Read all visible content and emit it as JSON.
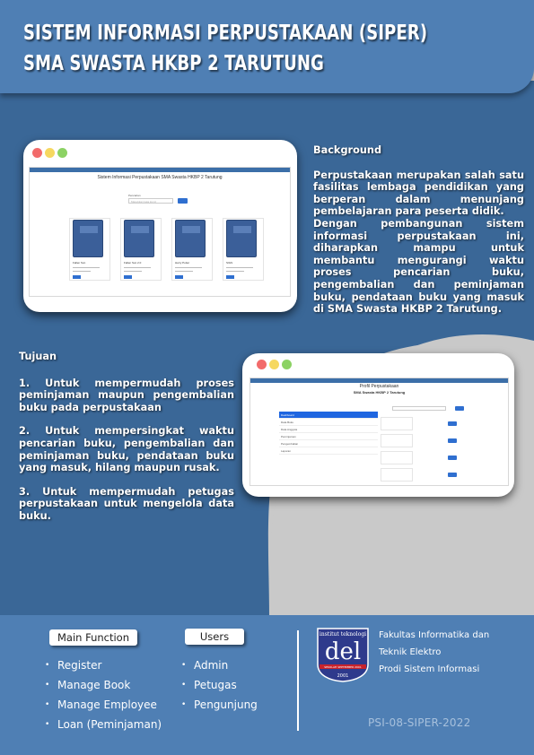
{
  "header": {
    "title_line1": "SISTEM INFORMASI PERPUSTAKAAN (SIPER)",
    "title_line2": "SMA SWASTA HKBP 2 TARUTUNG"
  },
  "colors": {
    "primary_blue": "#4f7fb4",
    "dark_blue": "#3a6797",
    "background_gray": "#c9c9c9",
    "button_blue": "#2f6fd0"
  },
  "mockup1": {
    "screen_title": "Sistem Informasi Perpustakaan SMA Swasta HKBP 2 Tarutung",
    "search_label": "Pencarian",
    "search_placeholder": "Masukkan kata kunci",
    "search_button": "Search",
    "books": [
      {
        "title": "Fallen Sun",
        "meta": "Penulis/Pengarang : Penerbit"
      },
      {
        "title": "Fallen Sun 2.0",
        "meta": "Penulis/Pengarang : Penerbit"
      },
      {
        "title": "Harry Potter",
        "meta": "Penulis/Pengarang : Penerbit"
      },
      {
        "title": "SIGS",
        "meta": "Penulis/Pengarang : Penerbit"
      }
    ],
    "book_button": "Detail"
  },
  "mockup2": {
    "screen_title": "Profil Perpustakaan",
    "screen_subtitle": "SMA Swasta HKBP 2 Tarutung",
    "menu": [
      "Dashboard",
      "Data Buku",
      "Data Anggota",
      "Peminjaman",
      "Pengembalian",
      "Laporan"
    ]
  },
  "background": {
    "heading": "Background",
    "paragraph1": "Perpustakaan merupakan salah satu fasilitas lembaga pendidikan yang berperan dalam menunjang pembelajaran para peserta didik.",
    "paragraph2": "Dengan pembangunan sistem informasi perpustakaan ini, diharapkan mampu untuk membantu mengurangi waktu proses pencarian buku, pengembalian dan peminjaman buku, pendataan buku yang masuk di SMA Swasta HKBP 2 Tarutung."
  },
  "tujuan": {
    "heading": "Tujuan",
    "items": [
      "1. Untuk mempermudah proses peminjaman maupun pengembalian buku pada perpustakaan",
      "2. Untuk mempersingkat waktu pencarian buku, pengembalian dan peminjaman buku, pendataan buku yang masuk, hilang maupun rusak.",
      "3. Untuk mempermudah petugas perpustakaan untuk mengelola data buku."
    ]
  },
  "footer": {
    "main_function_label": "Main Function",
    "main_functions": [
      "Register",
      "Manage Book",
      "Manage Employee",
      "Loan (Peminjaman)"
    ],
    "users_label": "Users",
    "users": [
      "Admin",
      "Petugas",
      "Pengunjung"
    ],
    "logo_top_text": "institut teknologi",
    "logo_main_text": "del",
    "logo_bottom_text": "SEKOLAH SEPTEMBER 2001",
    "logo_year": "2001",
    "faculty_line1": "Fakultas Informatika dan",
    "faculty_line2": "Teknik Elektro",
    "faculty_line3": "Prodi Sistem Informasi",
    "code": "PSI-08-SIPER-2022"
  }
}
